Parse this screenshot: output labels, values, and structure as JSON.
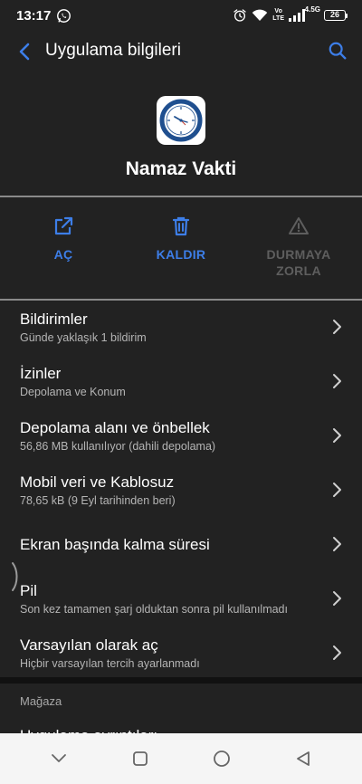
{
  "status_bar": {
    "time": "13:17",
    "network_label_top": "Vo",
    "network_label_bottom": "LTE",
    "signal_label": "4.5G",
    "battery": "26"
  },
  "app_bar": {
    "title": "Uygulama bilgileri"
  },
  "app": {
    "name": "Namaz Vakti"
  },
  "actions": [
    {
      "label": "AÇ",
      "enabled": true
    },
    {
      "label": "KALDIR",
      "enabled": true
    },
    {
      "label": "DURMAYA\nZORLA",
      "enabled": false
    }
  ],
  "list": [
    {
      "title": "Bildirimler",
      "subtitle": "Günde yaklaşık 1 bildirim"
    },
    {
      "title": "İzinler",
      "subtitle": "Depolama ve Konum"
    },
    {
      "title": "Depolama alanı ve önbellek",
      "subtitle": "56,86 MB kullanılıyor (dahili depolama)"
    },
    {
      "title": "Mobil veri ve Kablosuz",
      "subtitle": "78,65 kB (9 Eyl tarihinden beri)"
    },
    {
      "title": "Ekran başında kalma süresi",
      "subtitle": ""
    },
    {
      "title": "Pil",
      "subtitle": "Son kez tamamen şarj olduktan sonra pil kullanılmadı"
    },
    {
      "title": "Varsayılan olarak aç",
      "subtitle": "Hiçbir varsayılan tercih ayarlanmadı"
    }
  ],
  "store_section": {
    "header": "Mağaza",
    "item": "Uygulama ayrıntıları"
  },
  "colors": {
    "background": "#222222",
    "accent": "#3d7ee8",
    "disabled": "#5e5e5e",
    "divider": "#8a8a8a"
  }
}
